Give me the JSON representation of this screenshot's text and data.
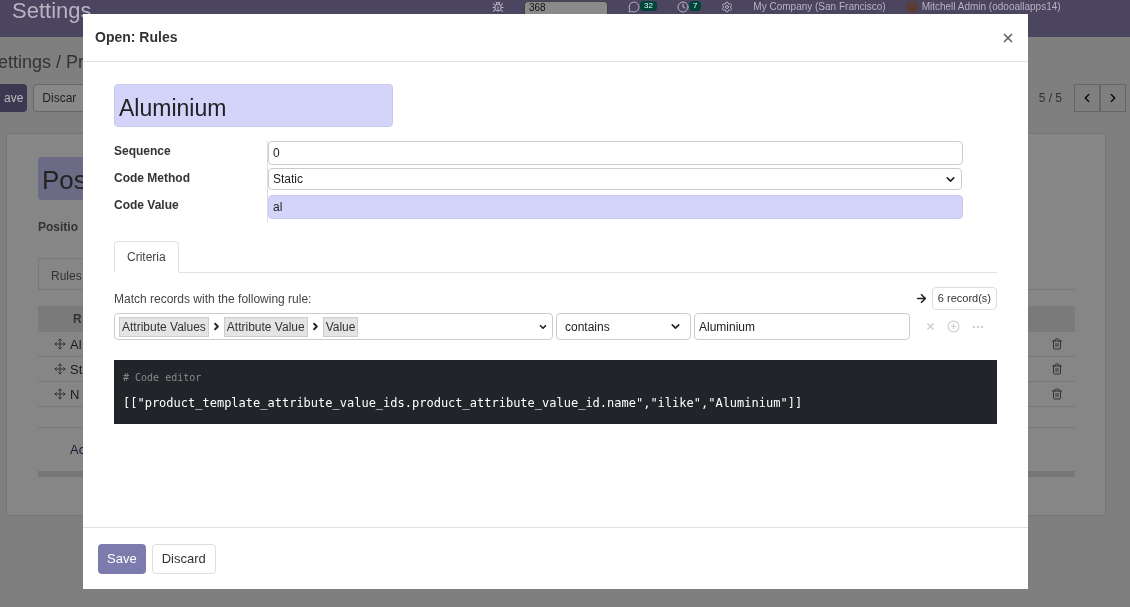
{
  "app": {
    "title": "Settings",
    "counter": "368",
    "messages_badge": "32",
    "activities_badge": "7",
    "company": "My Company (San Francisco)",
    "user": "Mitchell Admin (odooallapps14)"
  },
  "breadcrumb": "ettings / Pr",
  "actions": [
    "ave",
    "Discar"
  ],
  "pager": "5 / 5",
  "record": {
    "name": "Pos",
    "field_label": "Positio",
    "tab": "Rules",
    "column": "R",
    "rows": [
      "Al",
      "St",
      "N"
    ],
    "add_line": "Ac"
  },
  "dialog": {
    "title": "Open: Rules",
    "name": "Aluminium",
    "fields": [
      {
        "label": "Sequence",
        "kind": "text",
        "value": "0",
        "required": false
      },
      {
        "label": "Code Method",
        "kind": "select",
        "value": "Static",
        "required": false
      },
      {
        "label": "Code Value",
        "kind": "text",
        "value": "al",
        "required": true
      }
    ],
    "tabs": [
      {
        "label": "Criteria",
        "selected": true
      }
    ],
    "rule_intro": "Match records with the following rule:",
    "record_count": "6 record(s)",
    "path": [
      "Attribute Values",
      "Attribute Value",
      "Value"
    ],
    "operator": "contains",
    "value": "Aluminium",
    "code_comment": "# Code editor",
    "code": "[[\"product_template_attribute_value_ids.product_attribute_value_id.name\",\"ilike\",\"Aluminium\"]]",
    "buttons": [
      {
        "label": "Save",
        "primary": true
      },
      {
        "label": "Discard",
        "primary": false
      }
    ]
  }
}
